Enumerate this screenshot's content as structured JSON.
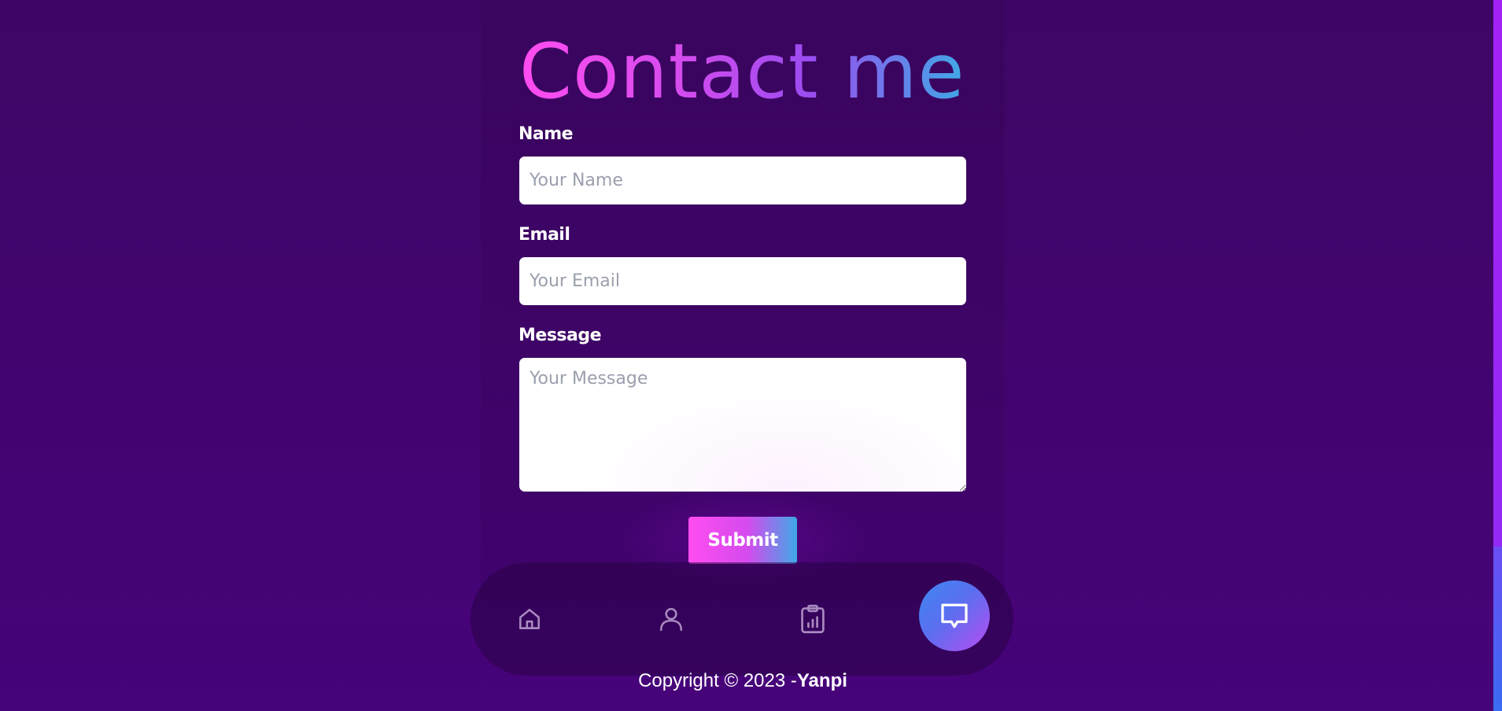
{
  "contact": {
    "title": "Contact me",
    "name_label": "Name",
    "name_placeholder": "Your Name",
    "name_value": "",
    "email_label": "Email",
    "email_placeholder": "Your Email",
    "email_value": "",
    "message_label": "Message",
    "message_placeholder": "Your Message",
    "message_value": "",
    "submit_label": "Submit"
  },
  "nav": {
    "items": [
      {
        "icon": "home-icon",
        "active": false
      },
      {
        "icon": "user-icon",
        "active": false
      },
      {
        "icon": "clipboard-chart-icon",
        "active": false
      },
      {
        "icon": "chat-icon",
        "active": true
      }
    ]
  },
  "footer": {
    "prefix": "Copyright © 2023 -",
    "author": "Yanpi"
  },
  "colors": {
    "background": "#45037a",
    "accent_pink": "#ff4cf0",
    "accent_blue": "#3fa9e6",
    "field_bg": "#ffffff"
  }
}
